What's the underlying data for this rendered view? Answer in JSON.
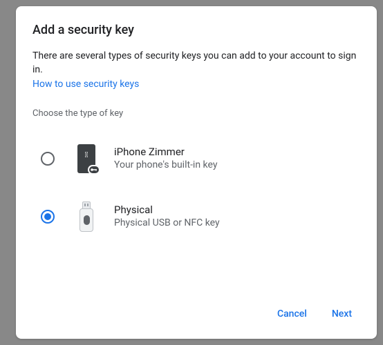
{
  "title": "Add a security key",
  "subtitle": "There are several types of security keys you can add to your account to sign in.",
  "help_link": "How to use security keys",
  "section_label": "Choose the type of key",
  "options": [
    {
      "label": "iPhone Zimmer",
      "desc": "Your phone's built-in key",
      "selected": false
    },
    {
      "label": "Physical",
      "desc": "Physical USB or NFC key",
      "selected": true
    }
  ],
  "buttons": {
    "cancel": "Cancel",
    "next": "Next"
  }
}
